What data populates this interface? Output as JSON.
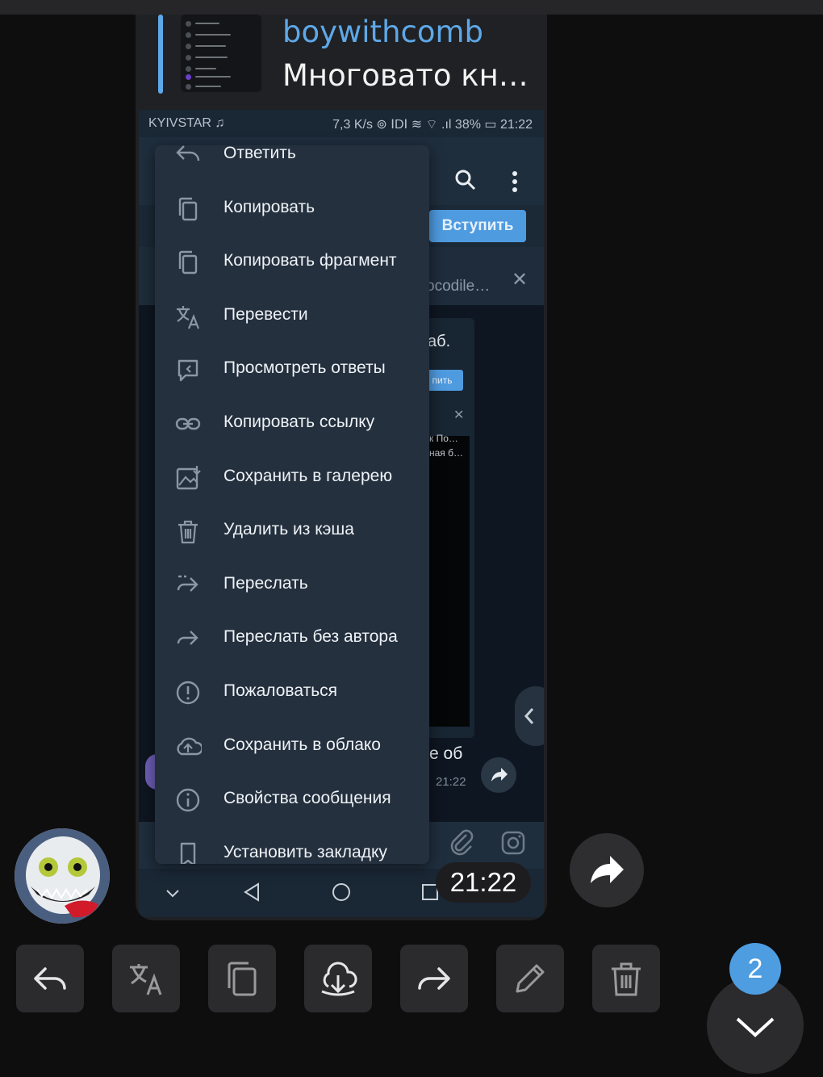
{
  "reply": {
    "author": "boywithcomb",
    "text": "Многовато кн…"
  },
  "phone": {
    "status": {
      "carrier": "KYIVSTAR ♫",
      "right": "7,3 K/s  ⊚ ⅠDⅠ ≋ ⌔  .ıl 38%  ▭  21:22"
    },
    "join_label": "Вступить",
    "pinned_snippet": "ocodile…",
    "bubble_text_top": "аб.",
    "bubble_mini_button": "пить",
    "bubble_mini_text1": "к По…",
    "bubble_mini_text2": "ная б…",
    "bubble_text_bottom": "е об",
    "bubble_time": "21:22"
  },
  "menu": {
    "items": [
      {
        "label": "Ответить",
        "icon": "reply-icon"
      },
      {
        "label": "Копировать",
        "icon": "copy-icon"
      },
      {
        "label": "Копировать фрагмент",
        "icon": "copy-fragment-icon"
      },
      {
        "label": "Перевести",
        "icon": "translate-icon"
      },
      {
        "label": "Просмотреть ответы",
        "icon": "view-replies-icon"
      },
      {
        "label": "Копировать ссылку",
        "icon": "link-icon"
      },
      {
        "label": "Сохранить в галерею",
        "icon": "gallery-save-icon"
      },
      {
        "label": "Удалить из кэша",
        "icon": "trash-icon"
      },
      {
        "label": "Переслать",
        "icon": "forward-icon"
      },
      {
        "label": "Переслать без автора",
        "icon": "forward-no-author-icon"
      },
      {
        "label": "Пожаловаться",
        "icon": "report-icon"
      },
      {
        "label": "Сохранить в облако",
        "icon": "cloud-upload-icon"
      },
      {
        "label": "Свойства сообщения",
        "icon": "info-icon"
      },
      {
        "label": "Установить закладку",
        "icon": "bookmark-icon"
      }
    ]
  },
  "message_time": "21:22",
  "unread_count": "2",
  "colors": {
    "accent": "#5ea8e8",
    "menu_bg": "#24303e",
    "page_bg": "#0e0e0f"
  }
}
